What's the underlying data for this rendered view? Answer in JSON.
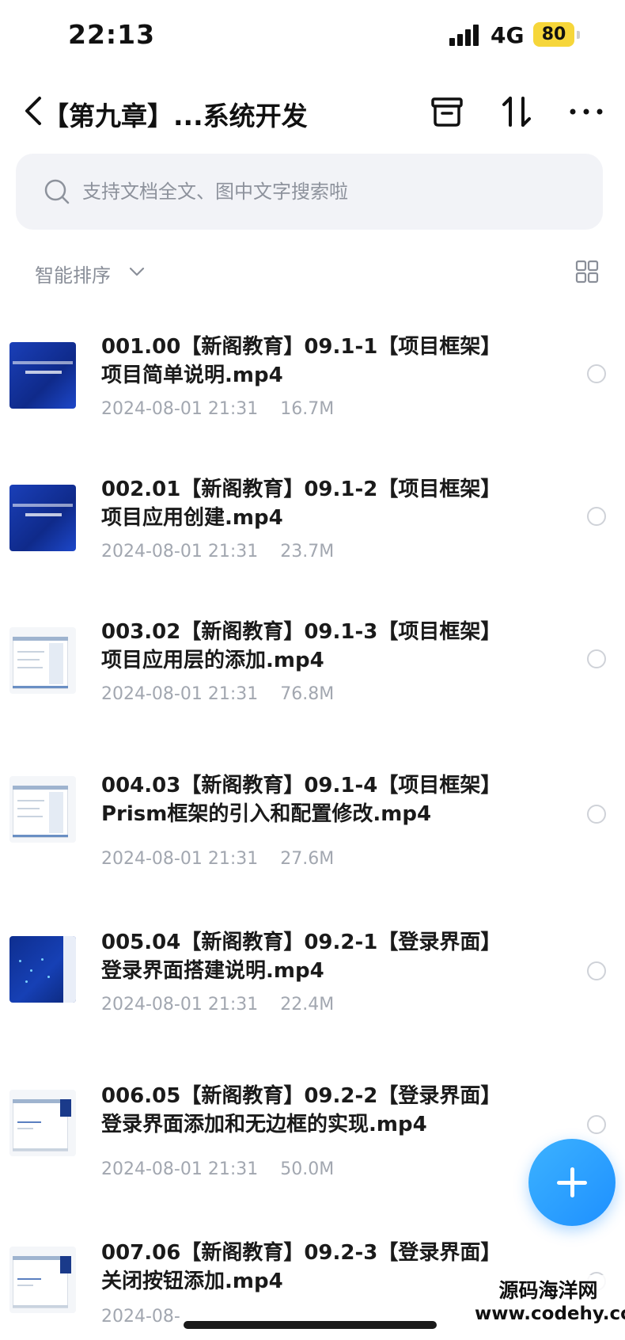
{
  "status_bar": {
    "time": "22:13",
    "network": "4G",
    "battery": "80",
    "battery_color": "#f6d63a"
  },
  "nav": {
    "title": "【第九章】...系统开发",
    "back_icon": "chevron-left-icon",
    "actions": [
      "archive-icon",
      "sort-icon",
      "more-icon"
    ]
  },
  "search": {
    "placeholder": "支持文档全文、图中文字搜索啦"
  },
  "toolbar": {
    "sort_label": "智能排序",
    "view_toggle_icon": "grid-view-icon"
  },
  "files": [
    {
      "name_line1": "001.00【新阁教育】09.1-1【项目框架】",
      "name_line2": "项目简单说明.mp4",
      "date": "2024-08-01 21:31",
      "size": "16.7M",
      "thumb": "blue"
    },
    {
      "name_line1": "002.01【新阁教育】09.1-2【项目框架】",
      "name_line2": "项目应用创建.mp4",
      "date": "2024-08-01 21:31",
      "size": "23.7M",
      "thumb": "blue"
    },
    {
      "name_line1": "003.02【新阁教育】09.1-3【项目框架】",
      "name_line2": "项目应用层的添加.mp4",
      "date": "2024-08-01 21:31",
      "size": "76.8M",
      "thumb": "screen"
    },
    {
      "name_line1": "004.03【新阁教育】09.1-4【项目框架】",
      "name_line2": "Prism框架的引入和配置修改.mp4",
      "date": "2024-08-01 21:31",
      "size": "27.6M",
      "thumb": "screen"
    },
    {
      "name_line1": "005.04【新阁教育】09.2-1【登录界面】",
      "name_line2": "登录界面搭建说明.mp4",
      "date": "2024-08-01 21:31",
      "size": "22.4M",
      "thumb": "blue2"
    },
    {
      "name_line1": "006.05【新阁教育】09.2-2【登录界面】",
      "name_line2": "登录界面添加和无边框的实现.mp4",
      "date": "2024-08-01 21:31",
      "size": "50.0M",
      "thumb": "screen-dark"
    },
    {
      "name_line1": "007.06【新阁教育】09.2-3【登录界面】",
      "name_line2": "关闭按钮添加.mp4",
      "date": "2024-08-",
      "size": "",
      "thumb": "screen-dark"
    }
  ],
  "fab": {
    "icon": "plus-icon",
    "color": "#1e90ff"
  },
  "watermark": {
    "line1": "源码海洋网",
    "line2": "www.codehy.com"
  }
}
